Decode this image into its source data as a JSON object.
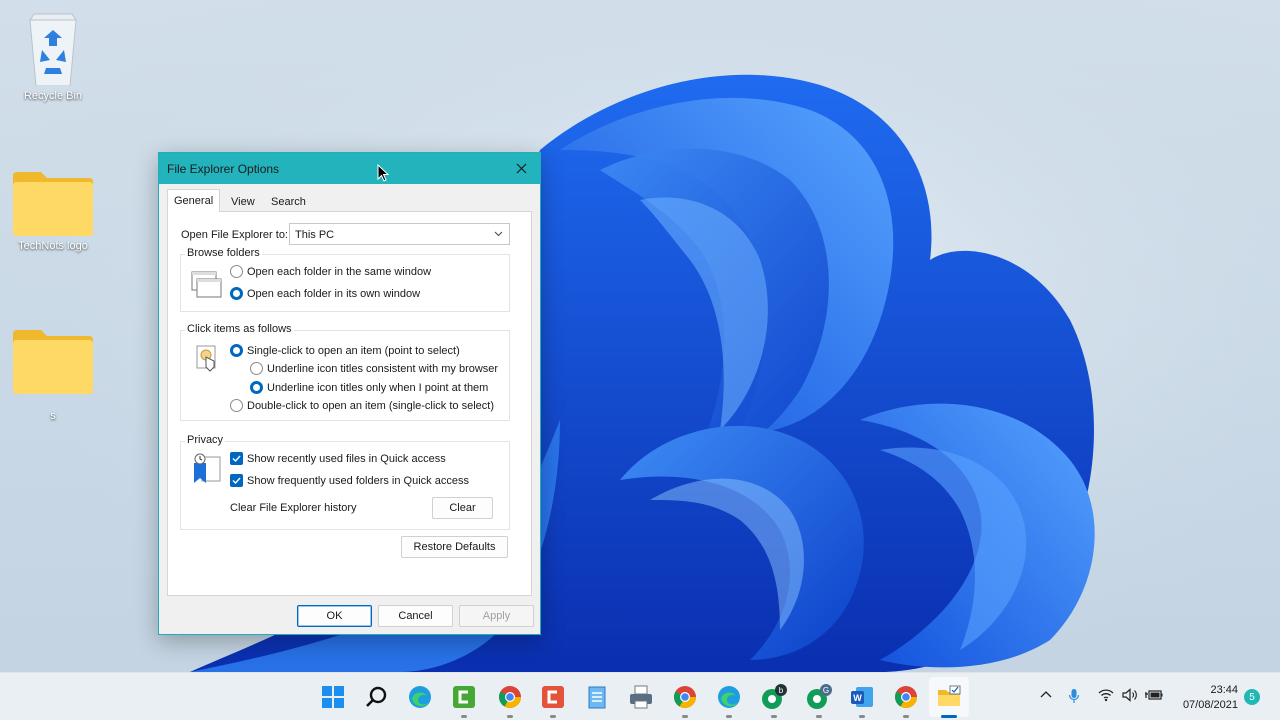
{
  "desktop": {
    "icons": [
      {
        "label": "Recycle Bin",
        "icon": "recycle-bin-icon"
      },
      {
        "label": "TechNots logo",
        "icon": "folder-icon"
      },
      {
        "label": "s",
        "icon": "folder-icon"
      }
    ]
  },
  "dialog": {
    "title": "File Explorer Options",
    "tabs": [
      "General",
      "View",
      "Search"
    ],
    "active_tab": "General",
    "open_to_label": "Open File Explorer to:",
    "open_to_value": "This PC",
    "browse_folders": {
      "title": "Browse folders",
      "options": [
        "Open each folder in the same window",
        "Open each folder in its own window"
      ],
      "selected": 1
    },
    "click_items": {
      "title": "Click items as follows",
      "single_click": "Single-click to open an item (point to select)",
      "underline_browser": "Underline icon titles consistent with my browser",
      "underline_point": "Underline icon titles only when I point at them",
      "double_click": "Double-click to open an item (single-click to select)",
      "selected_main": "single",
      "selected_underline": "point"
    },
    "privacy": {
      "title": "Privacy",
      "recent_files": "Show recently used files in Quick access",
      "frequent_folders": "Show frequently used folders in Quick access",
      "recent_checked": true,
      "frequent_checked": true,
      "clear_history_label": "Clear File Explorer history",
      "clear_button": "Clear"
    },
    "restore_defaults": "Restore Defaults",
    "ok": "OK",
    "cancel": "Cancel",
    "apply": "Apply"
  },
  "taskbar": {
    "apps": [
      "start-icon",
      "search-icon",
      "edge-icon",
      "camtasia-icon",
      "chrome-icon",
      "snagit-icon",
      "notepad-icon",
      "print-icon",
      "chrome-icon",
      "edge-icon",
      "chrome-profile-b-icon",
      "chrome-profile-g-icon",
      "word-icon",
      "chrome-icon",
      "file-explorer-icon"
    ],
    "time": "23:44",
    "date": "07/08/2021",
    "notifications": "5"
  },
  "colors": {
    "accent": "#0067c0",
    "titlebar": "#22b3bd",
    "wallpaper_blue": "#1a5fe0"
  }
}
